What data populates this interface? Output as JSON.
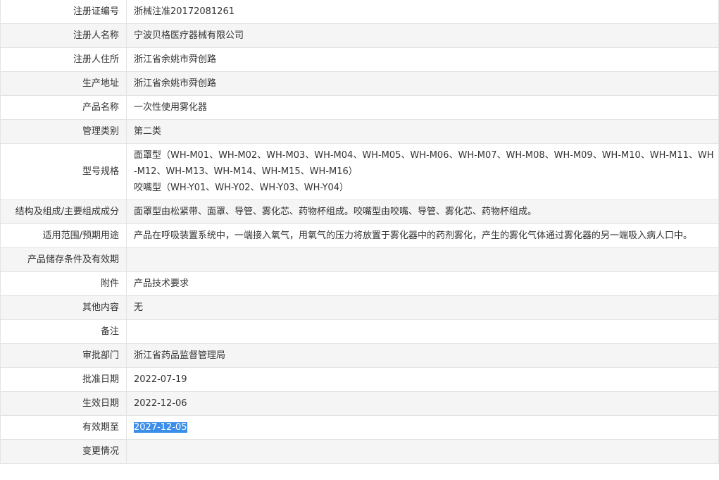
{
  "rows": [
    {
      "label": "注册证编号",
      "value": "浙械注准20172081261"
    },
    {
      "label": "注册人名称",
      "value": "宁波贝格医疗器械有限公司"
    },
    {
      "label": "注册人住所",
      "value": "浙江省余姚市舜创路"
    },
    {
      "label": "生产地址",
      "value": "浙江省余姚市舜创路"
    },
    {
      "label": "产品名称",
      "value": "一次性使用雾化器"
    },
    {
      "label": "管理类别",
      "value": "第二类"
    },
    {
      "label": "型号规格",
      "value_lines": [
        "面罩型（WH-M01、WH-M02、WH-M03、WH-M04、WH-M05、WH-M06、WH-M07、WH-M08、WH-M09、WH-M10、WH-M11、WH-M12、WH-M13、WH-M14、WH-M15、WH-M16）",
        "咬嘴型（WH-Y01、WH-Y02、WH-Y03、WH-Y04）"
      ]
    },
    {
      "label": "结构及组成/主要组成成分",
      "value": "面罩型由松紧带、面罩、导管、雾化芯、药物杯组成。咬嘴型由咬嘴、导管、雾化芯、药物杯组成。"
    },
    {
      "label": "适用范围/预期用途",
      "value": "产品在呼吸装置系统中，一端接入氧气，用氧气的压力将放置于雾化器中的药剂雾化，产生的雾化气体通过雾化器的另一端吸入病人口中。"
    },
    {
      "label": "产品储存条件及有效期",
      "value": ""
    },
    {
      "label": "附件",
      "value": "产品技术要求"
    },
    {
      "label": "其他内容",
      "value": "无"
    },
    {
      "label": "备注",
      "value": ""
    },
    {
      "label": "审批部门",
      "value": "浙江省药品监督管理局"
    },
    {
      "label": "批准日期",
      "value": "2022-07-19"
    },
    {
      "label": "生效日期",
      "value": "2022-12-06"
    },
    {
      "label": "有效期至",
      "value": "2027-12-05",
      "selected": true
    },
    {
      "label": "变更情况",
      "value": ""
    }
  ],
  "colors": {
    "border": "#e3e3e3",
    "stripe": "#f5f5f5",
    "selection": "#3b8eea",
    "text": "#333333"
  }
}
